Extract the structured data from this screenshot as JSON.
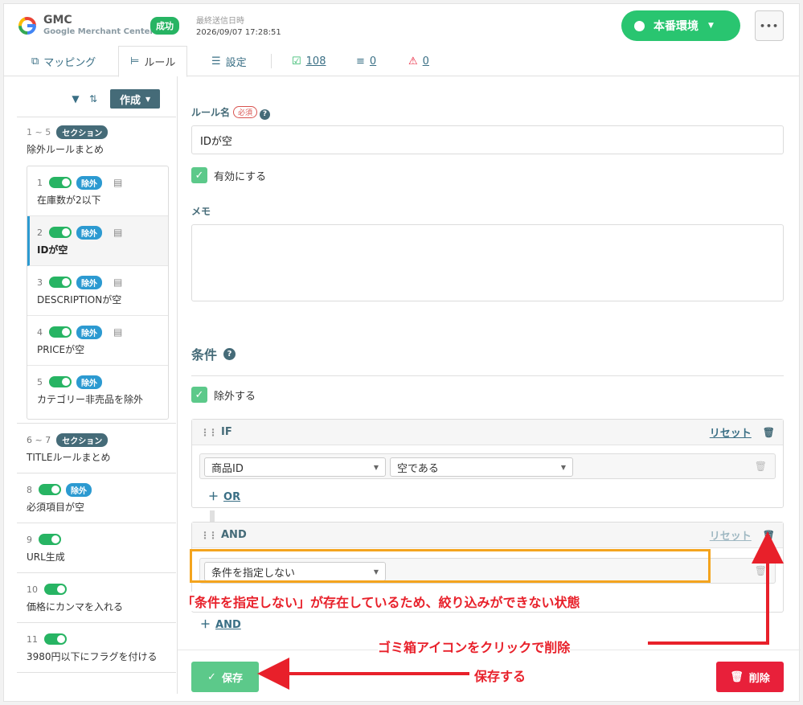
{
  "header": {
    "brand_title": "GMC",
    "brand_sub": "Google Merchant Center",
    "status_badge": "成功",
    "last_sent_label": "最終送信日時",
    "last_sent_time": "2026/09/07 17:28:51",
    "env_label": "本番環境",
    "more_label": "•••",
    "logo_letter": "G"
  },
  "tabs": {
    "mapping": "マッピング",
    "rules": "ルール",
    "settings": "設定",
    "count_ok": "108",
    "count_x": "0",
    "count_warn": "0"
  },
  "sidebar": {
    "create_label": "作成",
    "sections": [
      {
        "range": "1 ~ 5",
        "tag": "セクション",
        "name": "除外ルールまとめ"
      },
      {
        "range": "6 ~ 7",
        "tag": "セクション",
        "name": "TITLEルールまとめ"
      }
    ],
    "rules": [
      {
        "num": "1",
        "tag": "除外",
        "name": "在庫数が2以下"
      },
      {
        "num": "2",
        "tag": "除外",
        "name": "IDが空"
      },
      {
        "num": "3",
        "tag": "除外",
        "name": "DESCRIPTIONが空"
      },
      {
        "num": "4",
        "tag": "除外",
        "name": "PRICEが空"
      },
      {
        "num": "5",
        "tag": "除外",
        "name": "カテゴリー非売品を除外"
      }
    ],
    "other_rules": [
      {
        "num": "8",
        "tag": "除外",
        "name": "必須項目が空"
      },
      {
        "num": "9",
        "name": "URL生成"
      },
      {
        "num": "10",
        "name": "価格にカンマを入れる"
      },
      {
        "num": "11",
        "name": "3980円以下にフラグを付ける"
      }
    ]
  },
  "form": {
    "rule_name_label": "ルール名",
    "required_tag": "必須",
    "rule_name_value": "IDが空",
    "enabled_label": "有効にする",
    "memo_label": "メモ",
    "conditions_title": "条件",
    "exclude_label": "除外する"
  },
  "conditions": {
    "if_label": "IF",
    "reset_label": "リセット",
    "if_field": "商品ID",
    "if_operator": "空である",
    "or_label": "OR",
    "and_label": "AND",
    "and_field": "条件を指定しない",
    "and_add_label": "AND"
  },
  "footer": {
    "save_label": "保存",
    "delete_label": "削除"
  },
  "annotations": {
    "note_problem": "「条件を指定しない」が存在しているため、絞り込みができない状態",
    "note_trash": "ゴミ箱アイコンをクリックで削除",
    "note_save": "保存する"
  },
  "colors": {
    "accent_green": "#29c570",
    "section_teal": "#456b78",
    "exclude_blue": "#2c9ad1",
    "delete_red": "#e8203a",
    "annotation_red": "#e8202a",
    "highlight_orange": "#f4a41e"
  }
}
